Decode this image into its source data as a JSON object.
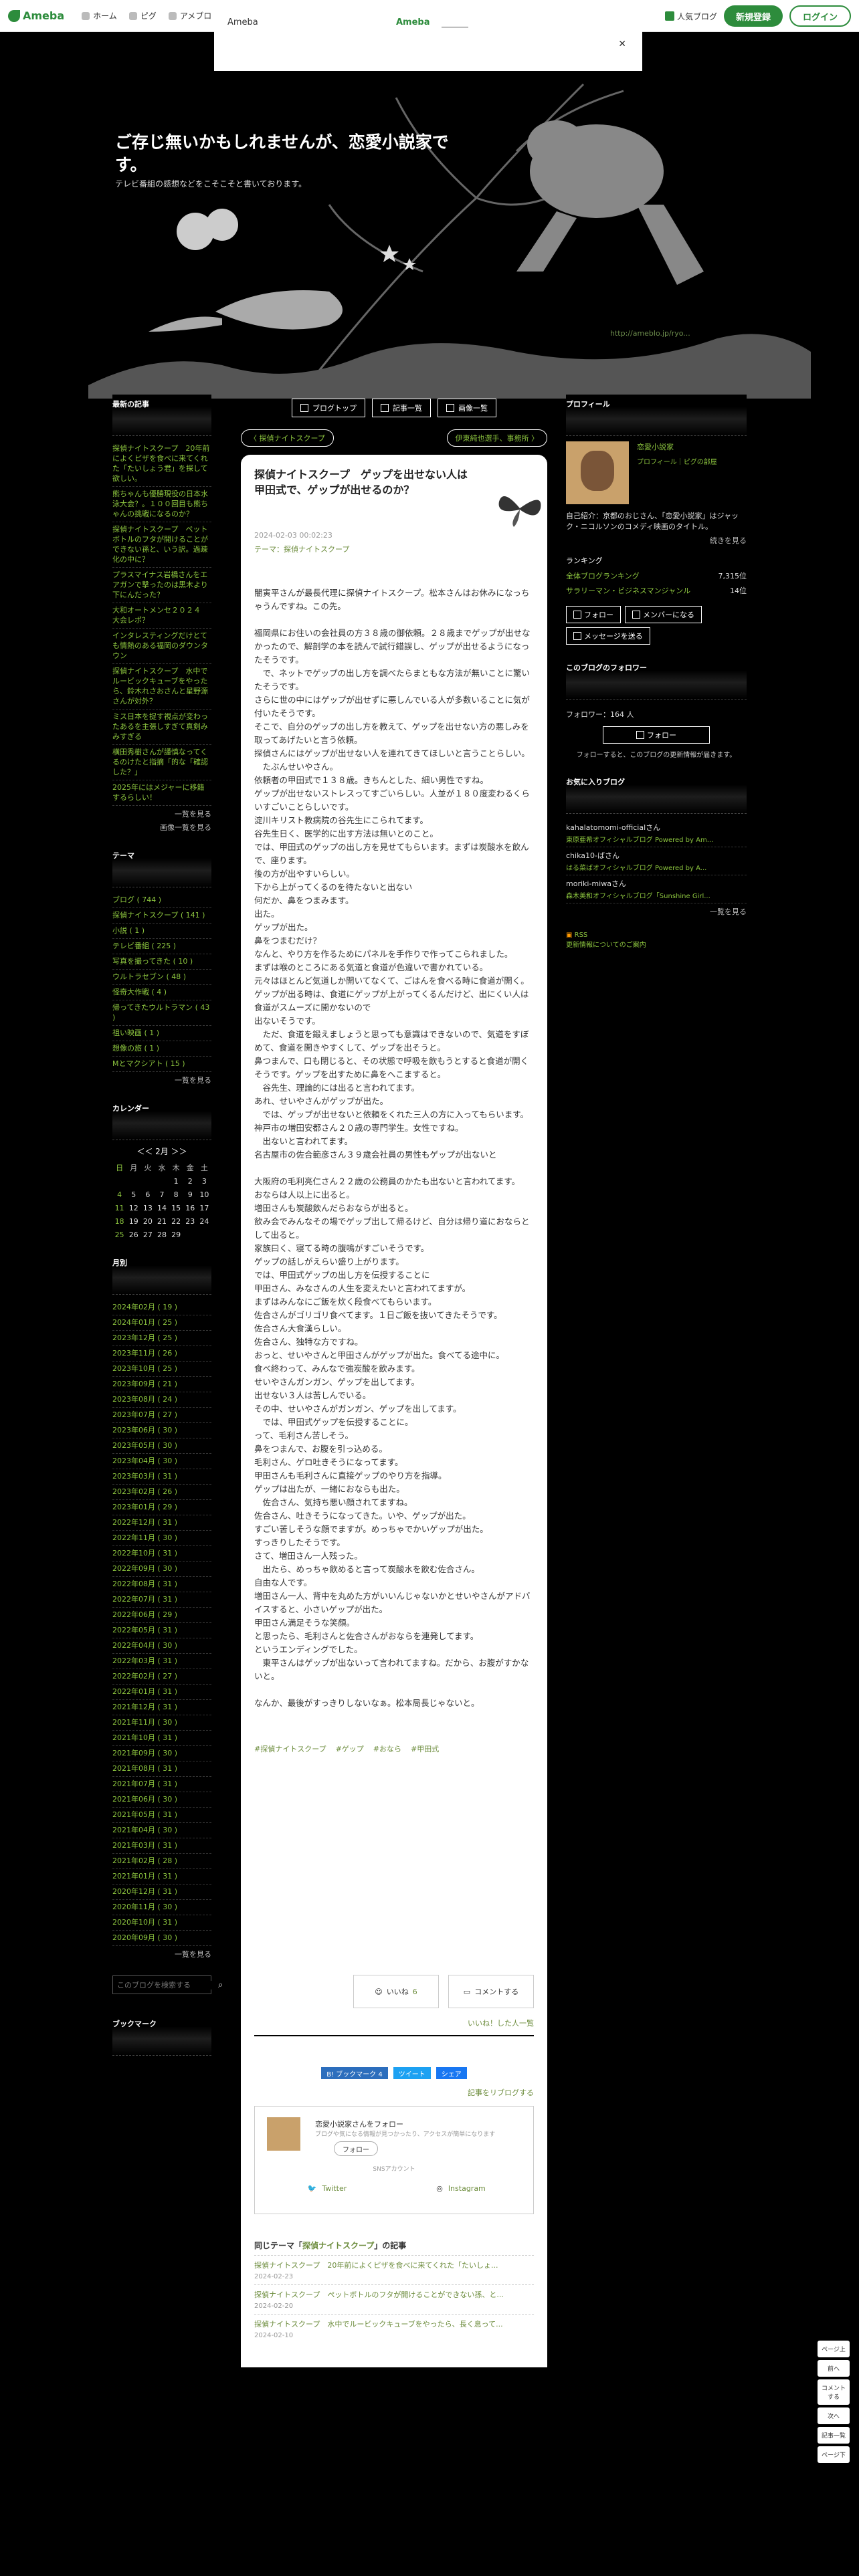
{
  "topbar": {
    "logo": "Ameba",
    "nav": [
      "ホーム",
      "ピグ",
      "アメブロ"
    ],
    "popular": "人気ブログ",
    "signup": "新規登録",
    "login": "ログイン"
  },
  "overlay": {
    "left": "Ameba",
    "center": "Ameba",
    "close": "✕"
  },
  "header": {
    "title": "ご存じ無いかもしれませんが、恋愛小説家です。",
    "description": "テレビ番組の感想などをこそこそと書いております。",
    "link": "http://ameblo.jp/ryo..."
  },
  "navbtns": [
    "ブログトップ",
    "記事一覧",
    "画像一覧"
  ],
  "pager": {
    "prev": "〈 探偵ナイトスクープ",
    "next": "伊東純也選手、事務所 〉"
  },
  "entry": {
    "title": "探偵ナイトスクープ　ゲップを出せない人は甲田式で、ゲップが出せるのか？",
    "date": "2024-02-03 00:02:23",
    "theme": "テーマ：探偵ナイトスクープ",
    "body": "闇寅平さんが最長代理に探偵ナイトスクープ。松本さんはお休みになっちゃうんですね。この先。\n\n福岡県にお住いの会社員の方３８歳の御依頼。２８歳までゲップが出せなかったので、解剖学の本を読んで試行錯誤し、ゲップが出せるようになったそうです。\n　で、ネットでゲップの出し方を調べたらまともな方法が無いことに驚いたそうです。\nさらに世の中にはゲップが出せずに悪しんでいる人が多数いることに気が付いたそうです。\nそこで、自分のゲップの出し方を教えて、ゲップを出せない方の悪しみを取ってあげたいと言う依頼。\n探偵さんにはゲップが出せない人を連れてきてほしいと言うことらしい。\n　たぶんせいやさん。\n依頼者の甲田式で１３８歳。きちんとした、細い男性ですね。\nゲップが出せないストレスってすごいらしい。人並が１８０度変わるくらいすごいことらしいです。\n淀川キリスト教病院の谷先生にこられてます。\n谷先生日く、医学的に出す方法は無いとのこと。\nでは、甲田式のゲップの出し方を見せてもらいます。まずは炭酸水を飲んで、座ります。\n後の方が出やすいらしい。\n下から上がってくるのを待たないと出ない\n何だか、鼻をつまみます。\n出た。\nゲップが出た。\n鼻をつまむだけ？\nなんと、やり方を作るためにパネルを手作りで作ってこられました。\nまずは喉のところにある気道と食道が色違いで書かれている。\n元々はほとんど気道しか開いてなくて、ごはんを食べる時に食道が開く。\nゲップが出る時は、食道にゲップが上がってくるんだけど、出にくい人は食道がスムーズに開かないので\n出ないそうです。\n　ただ、食道を鍛えましょうと思っても意識はできないので、気道をすぼめて、食道を開きやすくして、ゲップを出そうと。\n鼻つまんで、口も閉じると、その状態で呼吸を飲もうとすると食道が開くそうです。ゲップを出すために鼻をへこますると。\n　谷先生、理論的には出ると言われてます。\nあれ、せいやさんがゲップが出た。\n　では、ゲップが出せないと依頼をくれた三人の方に入ってもらいます。\n神戸市の増田安都さん２０歳の専門学生。女性ですね。\n　出ないと言われてます。\n名古屋市の佐合範彦さん３９歳会社員の男性もゲップが出ないと\n\n大阪府の毛利亮仁さん２２歳の公務員のかたも出ないと言われてます。\nおならは人以上に出ると。\n増田さんも炭酸飲んだらおならが出ると。\n飲み会でみんなその場でゲップ出して帰るけど、自分は帰り道におならとして出ると。\n家族曰く、寝てる時の腹鳴がすごいそうです。\nゲップの話しがえらい盛り上がります。\nでは、甲田式ゲップの出し方を伝授することに\n甲田さん、みなさんの人生を変えたいと言われてますが。\nまずはみんなにご飯を炊く段食べてもらいます。\n佐合さんがゴリゴリ食べてます。１日ご飯を抜いてきたそうです。\n佐合さん大食漢らしい。\n佐合さん、独特な方ですね。\nおっと、せいやさんと甲田さんがゲップが出た。食べてる途中に。\n食べ終わって、みんなで強炭酸を飲みます。\nせいやさんガンガン、ゲップを出してます。\n出せない３人は苦しんでいる。\nその中、せいやさんがガンガン、ゲップを出してます。\n　では、甲田式ゲップを伝授することに。\nって、毛利さん苦しそう。\n鼻をつまんで、お腹を引っ込める。\n毛利さん、ゲロ吐きそうになってます。\n甲田さんも毛利さんに直接ゲップのやり方を指導。\nゲップは出たが、一緒におならも出た。\n　佐合さん、気持ち悪い顔されてますね。\n佐合さん、吐きそうになってきた。いや、ゲップが出た。\nすごい苦しそうな顔でますが。めっちゃでかいゲップが出た。\nすっきりしたそうです。\nさて、増田さん一人残った。\n　出たら、めっちゃ飲めると言って炭酸水を飲む佐合さん。\n自由な人です。\n増田さん一人、背中を丸めた方がいいんじゃないかとせいやさんがアドバイスすると、小さいゲップが出た。\n甲田さん満足そうな笑顔。\nと思ったら、毛利さんと佐合さんがおならを連発してます。\nというエンディングでした。\n　東平さんはゲップが出ないって言われてますね。だから、お腹がすかないと。\n\nなんか、最後がすっきりしないなぁ。松本局長じゃないと。",
    "hashtags": [
      "#探偵ナイトスクープ",
      "#ゲップ",
      "#おなら",
      "#甲田式"
    ],
    "like_label": "いいね",
    "like_count": "6",
    "comment_label": "コメントする",
    "like_total": "いいね！した人一覧",
    "reblog": "記事をリブログする"
  },
  "share": {
    "hatena": "B! ブックマーク 4",
    "twitter": "ツイート",
    "facebook": "シェア"
  },
  "follow_box": {
    "name": "恋愛小説家さんをフォロー",
    "sub": "ブログや気になる情報が見つかったり、アクセスが簡単になります",
    "button": "フォロー",
    "sns": "SNSアカウント",
    "twitter": "Twitter",
    "instagram": "Instagram"
  },
  "related": {
    "heading_prefix": "同じテーマ「",
    "theme": "探偵ナイトスクープ",
    "heading_suffix": "」の記事",
    "items": [
      {
        "title": "探偵ナイトスクープ　20年前によくピザを食べに来てくれた「たいしょ...",
        "date": "2024-02-23"
      },
      {
        "title": "探偵ナイトスクープ　ペットボトルのフタが開けることができない孫、と...",
        "date": "2024-02-20"
      },
      {
        "title": "探偵ナイトスクープ　水中でルービックキューブをやったら、長く息って...",
        "date": "2024-02-10"
      }
    ]
  },
  "left_sidebar": {
    "recent_heading": "最新の記事",
    "recent": [
      "探偵ナイトスクープ　20年前によくピザを食べに来てくれた「たいしょう君」を探して欲しい。",
      "熊ちゃんも優勝現役の日本水泳大会？。１００回目も熊ちゃんの挑戦になるのか？",
      "探偵ナイトスクープ　ペットボトルのフタが開けることができない孫と、いう訳。過疎化の中に？",
      "プラスマイナス岩橋さんをエアガンで撃ったのは黒木より下にんだった？",
      "大和オートメンセ２０２４　大会レポ？",
      "インタレスティングだけとても情熱のある福岡のダウンタウン",
      "探偵ナイトスクープ　水中でルービックキューブをやったら、鈴木れさおさんと星野源さんが対外？",
      "ミス日本を捉す視点が変わったあるを主張しすぎて真剣みみすぎる",
      "横田秀樹さんが謹慎なってくるのけたと指摘「的な「確認した？」",
      "2025年にはメジャーに移籍するらしい！"
    ],
    "recent_more": "一覧を見る",
    "image_more": "画像一覧を見る",
    "theme_heading": "テーマ",
    "themes": [
      "ブログ ( 744 )",
      "探偵ナイトスクープ ( 141 )",
      "小説 ( 1 )",
      "テレビ番組 ( 225 )",
      "写真を撮ってきた ( 10 )",
      "ウルトラセブン ( 48 )",
      "怪奇大作戦 ( 4 )",
      "帰ってきたウルトラマン ( 43 )",
      "祖い映画 ( 1 )",
      "想像の旅 ( 1 )",
      "Mとマクシアト ( 15 )"
    ],
    "theme_more": "一覧を見る",
    "calendar_heading": "カレンダー",
    "calendar_month": "2月",
    "calendar_days": [
      "日",
      "月",
      "火",
      "水",
      "木",
      "金",
      "土"
    ],
    "calendar_weeks": [
      [
        "",
        "",
        "",
        "",
        "1",
        "2",
        "3"
      ],
      [
        "4",
        "5",
        "6",
        "7",
        "8",
        "9",
        "10"
      ],
      [
        "11",
        "12",
        "13",
        "14",
        "15",
        "16",
        "17"
      ],
      [
        "18",
        "19",
        "20",
        "21",
        "22",
        "23",
        "24"
      ],
      [
        "25",
        "26",
        "27",
        "28",
        "29",
        "",
        ""
      ]
    ],
    "archive_heading": "月別",
    "archives": [
      "2024年02月 ( 19 )",
      "2024年01月 ( 25 )",
      "2023年12月 ( 25 )",
      "2023年11月 ( 26 )",
      "2023年10月 ( 25 )",
      "2023年09月 ( 21 )",
      "2023年08月 ( 24 )",
      "2023年07月 ( 27 )",
      "2023年06月 ( 30 )",
      "2023年05月 ( 30 )",
      "2023年04月 ( 30 )",
      "2023年03月 ( 31 )",
      "2023年02月 ( 26 )",
      "2023年01月 ( 29 )",
      "2022年12月 ( 31 )",
      "2022年11月 ( 30 )",
      "2022年10月 ( 31 )",
      "2022年09月 ( 30 )",
      "2022年08月 ( 31 )",
      "2022年07月 ( 31 )",
      "2022年06月 ( 29 )",
      "2022年05月 ( 31 )",
      "2022年04月 ( 30 )",
      "2022年03月 ( 31 )",
      "2022年02月 ( 27 )",
      "2022年01月 ( 31 )",
      "2021年12月 ( 31 )",
      "2021年11月 ( 30 )",
      "2021年10月 ( 31 )",
      "2021年09月 ( 30 )",
      "2021年08月 ( 31 )",
      "2021年07月 ( 31 )",
      "2021年06月 ( 30 )",
      "2021年05月 ( 31 )",
      "2021年04月 ( 30 )",
      "2021年03月 ( 31 )",
      "2021年02月 ( 28 )",
      "2021年01月 ( 31 )",
      "2020年12月 ( 31 )",
      "2020年11月 ( 30 )",
      "2020年10月 ( 31 )",
      "2020年09月 ( 30 )"
    ],
    "archive_more": "一覧を見る",
    "search_placeholder": "このブログを検索する",
    "bookmark_heading": "ブックマーク"
  },
  "right_sidebar": {
    "profile_heading": "プロフィール",
    "profile_name": "恋愛小説家",
    "profile_links": "プロフィール｜ピグの部屋",
    "profile_text": "自己紹介：京都のおじさん、「恋愛小説家」はジャック・ニコルソンのコメディ映画のタイトル。",
    "profile_more": "続きを見る",
    "ranking_heading": "ランキング",
    "ranks": [
      {
        "label": "全体ブログランキング",
        "value": "7,315位"
      },
      {
        "label": "サラリーマン・ビジネスマンジャンル",
        "value": "14位"
      }
    ],
    "btn_follow": "フォロー",
    "btn_member": "メンバーになる",
    "btn_message": "メッセージを送る",
    "followers_heading": "このブログのフォロワー",
    "followers": "フォロワー：164 人",
    "followers_btn": "フォロー",
    "followers_note": "フォローすると、このブログの更新情報が届きます。",
    "fav_heading": "お気に入りブログ",
    "favs": [
      {
        "name": "kahalatomomi-officialさん",
        "blog": "東原亜希オフィシャルブログ Powered by Am..."
      },
      {
        "name": "chika10-ばさん",
        "blog": "はる菜ばオフィシャルブログ Powered by A..."
      },
      {
        "name": "moriki-miwaさん",
        "blog": "森木美和オフィシャルブログ「Sunshine Girl..."
      }
    ],
    "fav_more": "一覧を見る",
    "rss": "RSS",
    "rss_note": "更新情報についてのご案内"
  },
  "sidetools": [
    "ページ上",
    "前へ",
    "コメントする",
    "次へ",
    "記事一覧",
    "ページ下"
  ]
}
